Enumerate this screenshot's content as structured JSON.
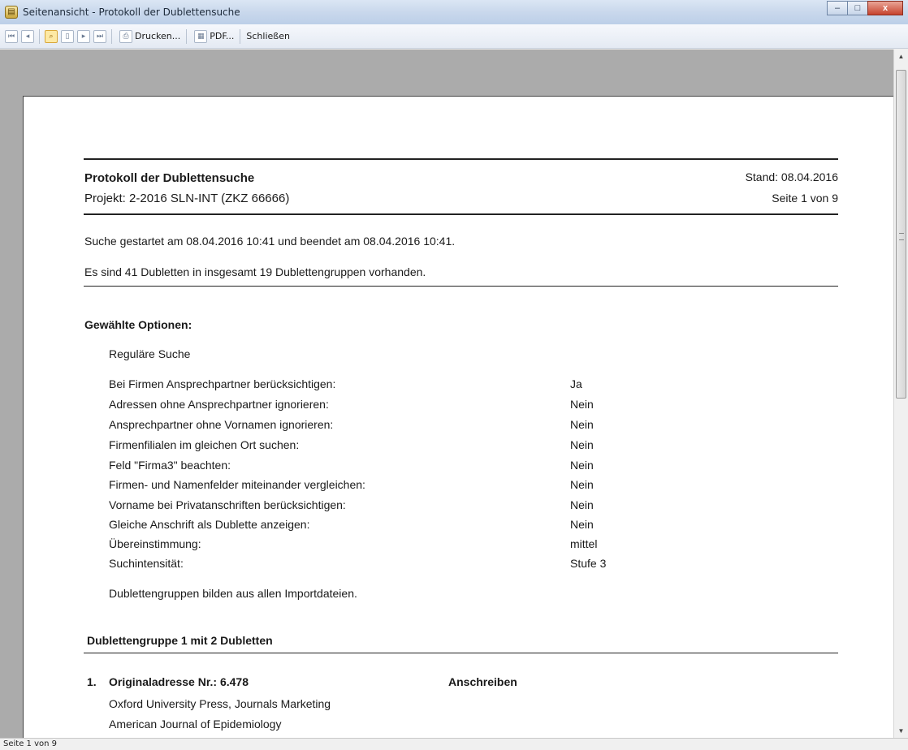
{
  "window": {
    "title": "Seitenansicht - Protokoll der Dublettensuche",
    "minimize": "–",
    "maximize": "□",
    "close": "x"
  },
  "toolbar": {
    "print_label": "Drucken...",
    "pdf_label": "PDF...",
    "close_label": "Schließen"
  },
  "report": {
    "title": "Protokoll der Dublettensuche",
    "project": "Projekt: 2-2016 SLN-INT  (ZKZ 66666)",
    "stand": "Stand: 08.04.2016",
    "page": "Seite 1 von 9",
    "search_info": "Suche gestartet am 08.04.2016 10:41 und beendet am 08.04.2016 10:41.",
    "summary": "Es sind 41 Dubletten in insgesamt 19 Dublettengruppen vorhanden.",
    "options_heading": "Gewählte Optionen:",
    "search_mode": "Reguläre Suche",
    "options": [
      {
        "label": "Bei Firmen Ansprechpartner berücksichtigen:",
        "value": "Ja"
      },
      {
        "label": "Adressen ohne Ansprechpartner ignorieren:",
        "value": "Nein"
      },
      {
        "label": "Ansprechpartner ohne Vornamen ignorieren:",
        "value": "Nein"
      },
      {
        "label": "Firmenfilialen im gleichen Ort suchen:",
        "value": "Nein"
      },
      {
        "label": "Feld \"Firma3\" beachten:",
        "value": "Nein"
      },
      {
        "label": "Firmen- und Namenfelder miteinander vergleichen:",
        "value": "Nein"
      },
      {
        "label": "Vorname bei Privatanschriften berücksichtigen:",
        "value": "Nein"
      },
      {
        "label": "Gleiche Anschrift als Dublette anzeigen:",
        "value": "Nein"
      },
      {
        "label": "Übereinstimmung:",
        "value": "mittel"
      },
      {
        "label": "Suchintensität:",
        "value": "Stufe 3"
      }
    ],
    "groups_note": "Dublettengruppen bilden aus allen Importdateien.",
    "group_heading": "Dublettengruppe 1 mit 2 Dubletten",
    "entry": {
      "number": "1.",
      "title": "Originaladresse Nr.: 6.478",
      "action": "Anschreiben",
      "line1": "Oxford University Press, Journals Marketing",
      "line2": "American Journal of Epidemiology"
    }
  },
  "status": {
    "page_info": "Seite 1 von 9"
  }
}
